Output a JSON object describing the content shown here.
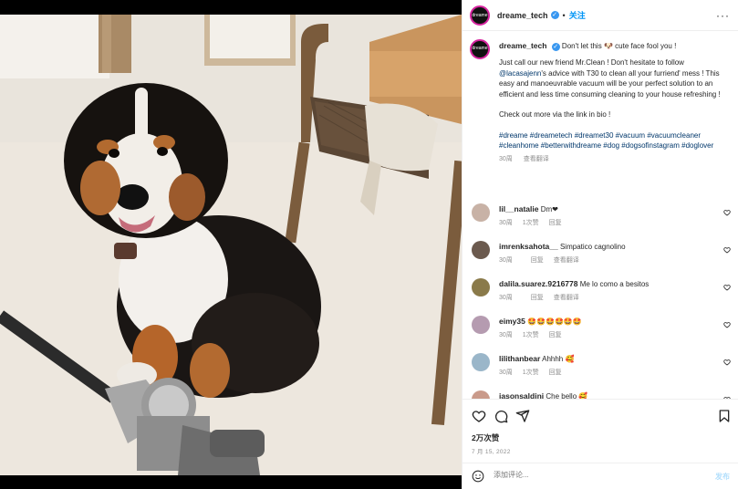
{
  "post": {
    "username": "dreame_tech",
    "verified_mark": "✓",
    "separator": "•",
    "follow_label": "关注",
    "more_label": "···",
    "avatar_text": "dreame"
  },
  "caption": {
    "username": "dreame_tech",
    "line1_a": "Don't let this",
    "line1_emoji": "🐶",
    "line1_b": "cute face fool you !",
    "p2_a": "Just call our new friend Mr.Clean ! Don't hesitate to follow",
    "p2_link": "@lacasajenn",
    "p2_b": "'s advice with T30 to clean all your furriend' mess ! This easy and manoeuvrable vacuum will be your perfect solution to an efficient and less time consuming cleaning to your house refreshing !",
    "p3": "Check out more via the link in bio !",
    "hashtags": "#dreame #dreametech #dreamet30 #vacuum #vacuumcleaner #cleanhome #betterwithdreame #dog #dogsofinstagram #doglover",
    "time": "30周",
    "see_translation": "查看翻译"
  },
  "comments": [
    {
      "user": "lil__natalie",
      "text": "Dm❤",
      "time": "30周",
      "likes": "1次赞",
      "reply": "回复",
      "translate": "",
      "avatar_color": "#c8b2a6"
    },
    {
      "user": "imrenksahota__",
      "text": "Simpatico cagnolino",
      "time": "30周",
      "likes": "",
      "reply": "回复",
      "translate": "查看翻译",
      "avatar_color": "#6b5a4e"
    },
    {
      "user": "dalila.suarez.9216778",
      "text": "Me lo como a besitos",
      "time": "30周",
      "likes": "",
      "reply": "回复",
      "translate": "查看翻译",
      "avatar_color": "#8a7a4a"
    },
    {
      "user": "eimy35",
      "text": "🤩🤩🤩🤩🤩🤩",
      "time": "30周",
      "likes": "1次赞",
      "reply": "回复",
      "translate": "",
      "avatar_color": "#b59bb0"
    },
    {
      "user": "lilithanbear",
      "text": "Ahhhh 🥰",
      "time": "30周",
      "likes": "1次赞",
      "reply": "回复",
      "translate": "",
      "avatar_color": "#9ab6c9"
    },
    {
      "user": "jasonsaldini",
      "text": "Che bello 🥰",
      "time": "",
      "likes": "",
      "reply": "",
      "translate": "",
      "avatar_color": "#c99a8a"
    }
  ],
  "actions": {
    "likes": "2万次赞",
    "date": "7 月 15, 2022"
  },
  "add_comment": {
    "placeholder": "添加评论...",
    "post_label": "发布"
  },
  "colors": {
    "accent": "#0095f6",
    "text": "#262626",
    "muted": "#8e8e8e",
    "link": "#00376b"
  }
}
